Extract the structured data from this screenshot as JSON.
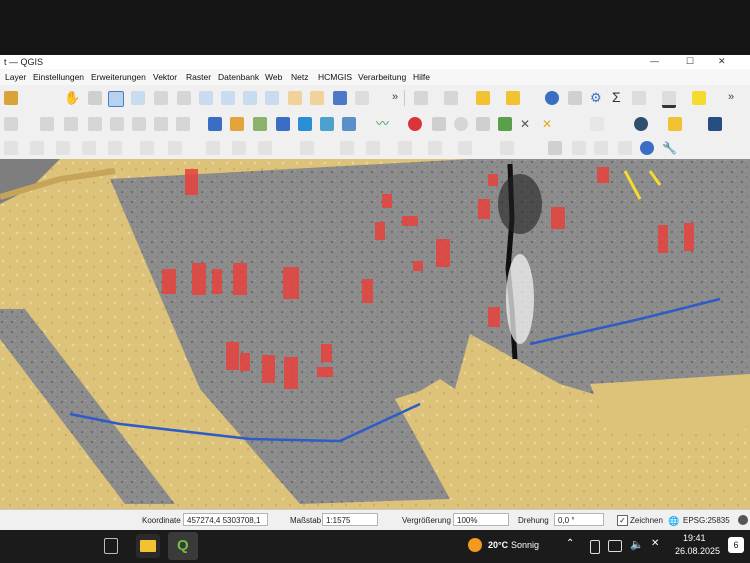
{
  "window": {
    "title": "t — QGIS",
    "controls": {
      "minimize": "—",
      "maximize": "☐",
      "close": "✕"
    }
  },
  "menu": {
    "items": [
      "Layer",
      "Einstellungen",
      "Erweiterungen",
      "Vektor",
      "Raster",
      "Datenbank",
      "Web",
      "Netz",
      "HCMGIS",
      "Verarbeitung",
      "Hilfe"
    ]
  },
  "toolbar": {
    "overflow": "»",
    "sigma": "Σ"
  },
  "status": {
    "coord_label": "Koordinate",
    "coord_value": "457274,4  5303708,1",
    "scale_label": "Maßstab",
    "scale_value": "1:1575",
    "magnifier_label": "Vergrößerung",
    "magnifier_value": "100%",
    "rotation_label": "Drehung",
    "rotation_value": "0,0 °",
    "render_label": "Zeichnen",
    "crs": "EPSG:25835"
  },
  "taskbar": {
    "weather_temp": "20°C",
    "weather_desc": "Sonnig",
    "time": "19:41",
    "date": "26.08.2025",
    "notification_count": "6",
    "qgis_letter": "Q"
  },
  "colors": {
    "sand": "#ddc27a",
    "survey_gray": "#8d8d8d",
    "feature_red": "#e8413c",
    "line_blue": "#2d5cc8",
    "highlight_yellow": "#f5dc2c"
  }
}
